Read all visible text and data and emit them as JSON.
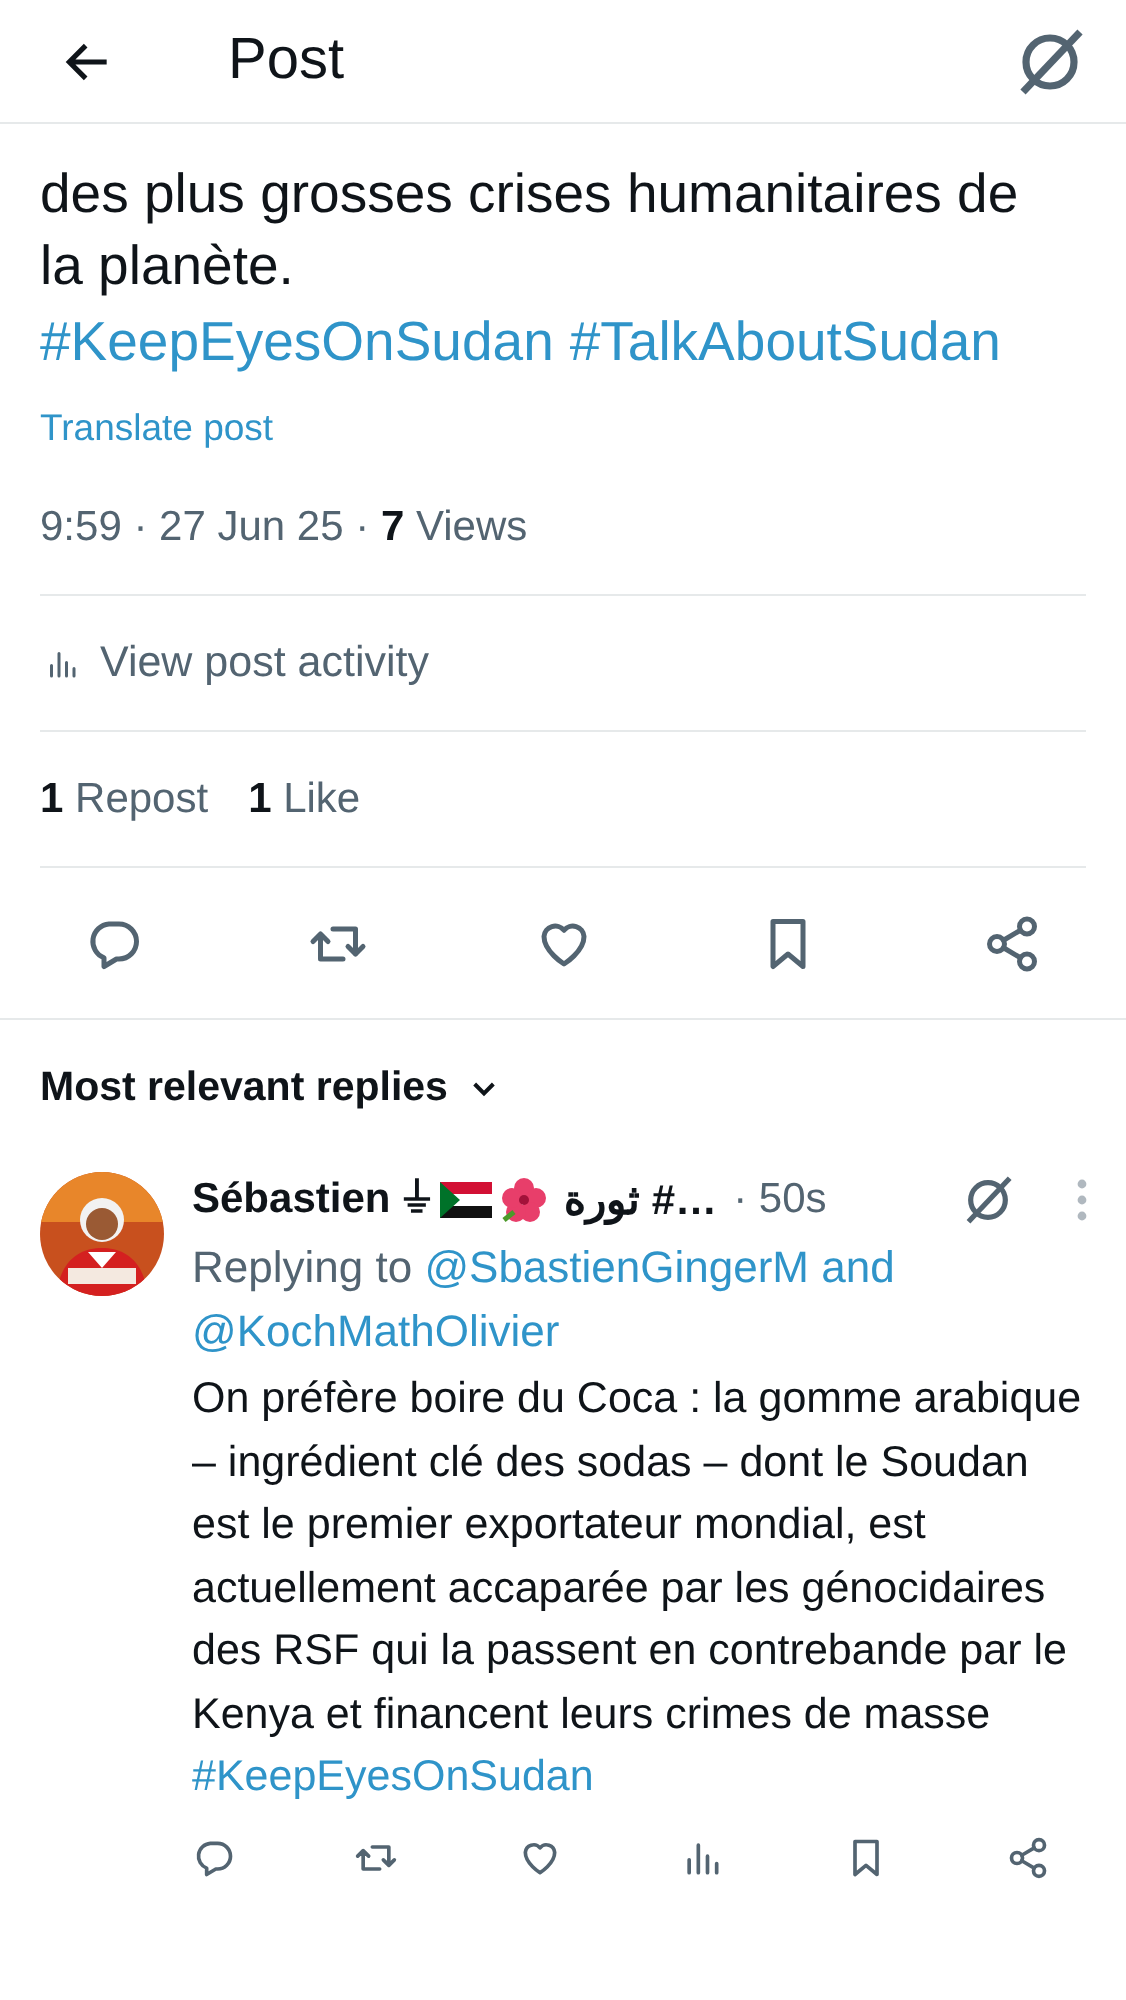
{
  "header": {
    "title": "Post"
  },
  "post": {
    "text_lines": [
      "des plus grosses crises humanitaires de",
      "la planète."
    ],
    "hashtags": [
      "#KeepEyesOnSudan",
      "#TalkAboutSudan"
    ],
    "translate": "Translate post",
    "meta": "9:59 · 27 Jun 25 · ",
    "views_count": "7",
    "views_label": " Views",
    "activity": "View post activity",
    "stats": [
      {
        "count": "1",
        "label": "Repost"
      },
      {
        "count": "1",
        "label": "Like"
      }
    ]
  },
  "actions": [
    {
      "kind": "reply"
    },
    {
      "kind": "repost"
    },
    {
      "kind": "like"
    },
    {
      "kind": "bookmark"
    },
    {
      "kind": "share"
    }
  ],
  "replies_heading": "Most relevant replies",
  "reply": {
    "name": "Sébastien ⏚",
    "name_tail": "ثورة #…",
    "time": "· 50s",
    "replying_to": "Replying to",
    "mentions": [
      "@SbastienGingerM",
      "@KochMathOlivier"
    ],
    "and": "and",
    "body": "On préfère boire du Coca : la gomme arabique – ingrédient clé des sodas – dont le Soudan est le premier exportateur mondial, est actuellement accaparée par les génocidaires des RSF qui la passent en contrebande par le Kenya et financent leurs crimes de masse",
    "hashtag": "#KeepEyesOnSudan",
    "actions": [
      {
        "kind": "reply"
      },
      {
        "kind": "repost"
      },
      {
        "kind": "like"
      },
      {
        "kind": "views"
      },
      {
        "kind": "bookmark"
      },
      {
        "kind": "share"
      }
    ]
  }
}
